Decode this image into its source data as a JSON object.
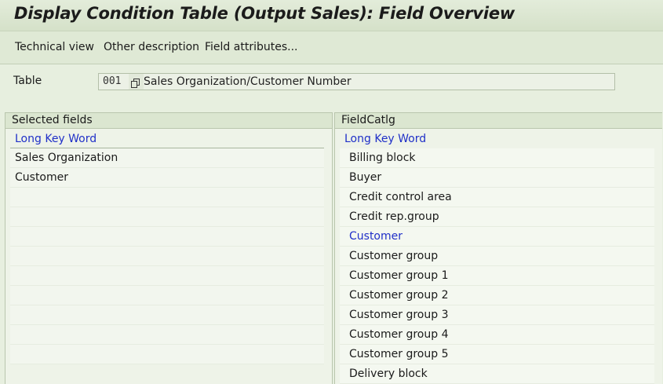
{
  "window": {
    "title": "Display Condition Table (Output Sales): Field Overview"
  },
  "toolbar": {
    "technical_view": "Technical view",
    "other_description": "Other description",
    "field_attributes": "Field attributes..."
  },
  "form": {
    "table_label": "Table",
    "table_value": "001",
    "table_description": "Sales Organization/Customer Number"
  },
  "selected_panel": {
    "title": "Selected fields",
    "column_header": "Long Key Word",
    "rows": [
      "Sales Organization",
      "Customer",
      "",
      "",
      "",
      "",
      "",
      "",
      "",
      "",
      ""
    ]
  },
  "catalog_panel": {
    "title": "FieldCatlg",
    "column_header": "Long Key Word",
    "rows": [
      "Billing block",
      "Buyer",
      "Credit control area",
      "Credit rep.group",
      "Customer",
      "Customer group",
      "Customer group 1",
      "Customer group 2",
      "Customer group 3",
      "Customer group 4",
      "Customer group 5",
      "Delivery block"
    ],
    "highlighted_row": "Customer"
  },
  "colors": {
    "highlight": "#2030c8",
    "background": "#e7efdf"
  }
}
